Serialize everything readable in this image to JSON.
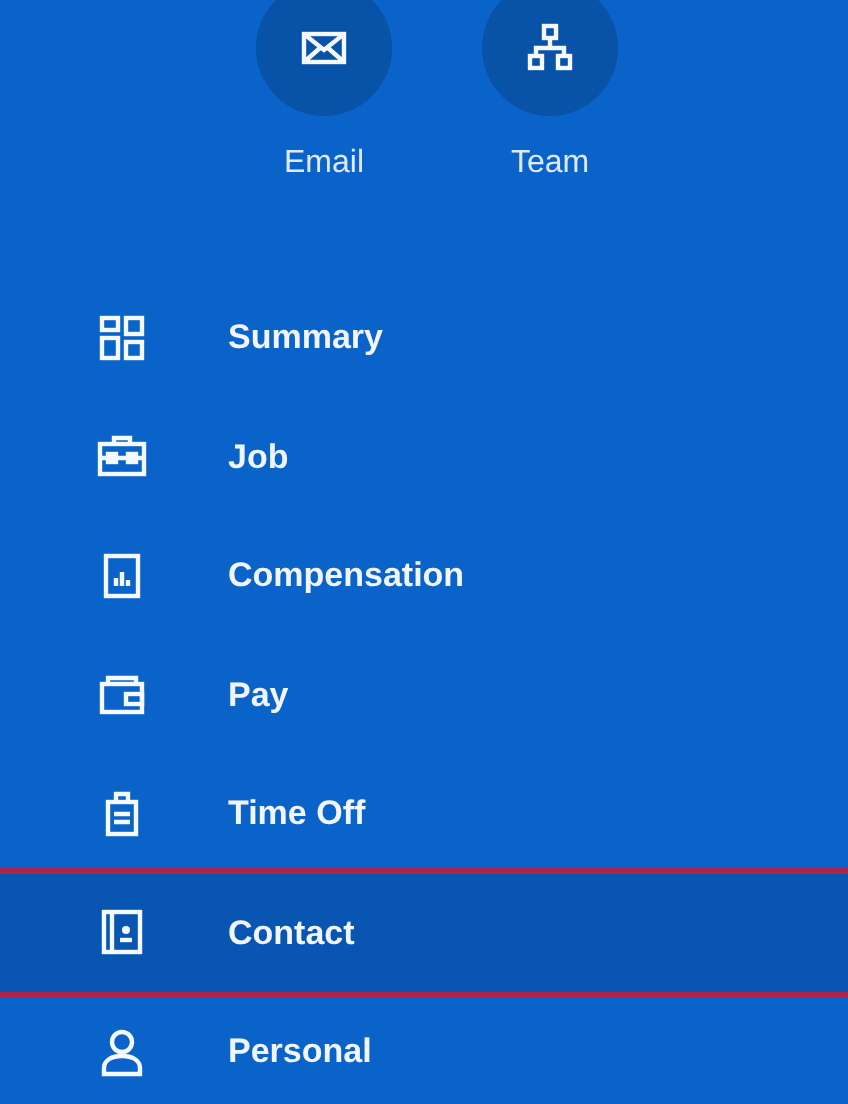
{
  "quick_actions": [
    {
      "kind": "email",
      "label": "Email"
    },
    {
      "kind": "team",
      "label": "Team"
    }
  ],
  "menu": [
    {
      "kind": "summary",
      "label": "Summary",
      "selected": false,
      "highlighted": false
    },
    {
      "kind": "job",
      "label": "Job",
      "selected": false,
      "highlighted": false
    },
    {
      "kind": "compensation",
      "label": "Compensation",
      "selected": false,
      "highlighted": false
    },
    {
      "kind": "pay",
      "label": "Pay",
      "selected": false,
      "highlighted": false
    },
    {
      "kind": "timeoff",
      "label": "Time Off",
      "selected": false,
      "highlighted": false
    },
    {
      "kind": "contact",
      "label": "Contact",
      "selected": true,
      "highlighted": true
    },
    {
      "kind": "personal",
      "label": "Personal",
      "selected": false,
      "highlighted": false
    }
  ]
}
